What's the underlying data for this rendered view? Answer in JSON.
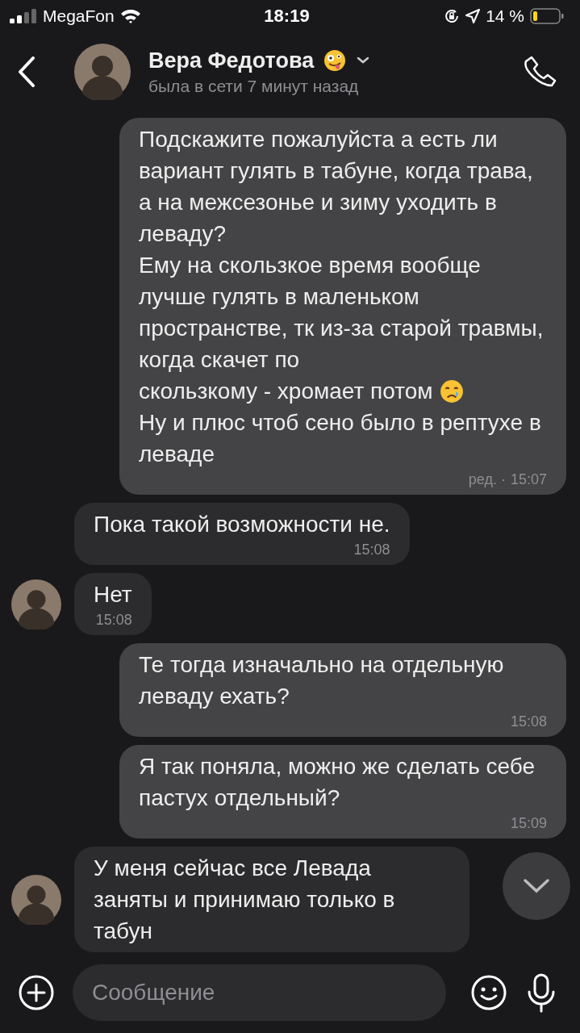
{
  "status_bar": {
    "carrier": "MegaFon",
    "time": "18:19",
    "battery": "14 %"
  },
  "header": {
    "name": "Вера Федотова",
    "status": "была в сети 7 минут назад"
  },
  "messages": [
    {
      "kind": "outgoing",
      "parts": [
        {
          "kind": "text",
          "text": "Подскажите пожалуйста а есть ли вариант гулять в табуне, когда трава, а на межсезонье и зиму уходить в леваду?"
        },
        {
          "kind": "text",
          "text": "Ему на скользкое время вообще лучше гулять в маленьком пространстве, тк из-за старой травмы, когда скачет по"
        },
        {
          "kind": "text",
          "text": "скользкому - хромает потом",
          "crying_emoji": true
        },
        {
          "kind": "text",
          "text": "Ну и плюс чтоб сено было в рептухе в леваде"
        }
      ],
      "edited": "ред. ·",
      "time": "15:07"
    },
    {
      "kind": "incoming",
      "show_avatar": false,
      "parts": [
        {
          "kind": "text",
          "text": "Пока такой возможности не."
        }
      ],
      "time": "15:08"
    },
    {
      "kind": "incoming",
      "show_avatar": true,
      "parts": [
        {
          "kind": "text",
          "text": "Нет"
        }
      ],
      "time": "15:08"
    },
    {
      "kind": "outgoing",
      "parts": [
        {
          "kind": "text",
          "text": "Те тогда изначально на отдельную леваду ехать?"
        }
      ],
      "time": "15:08"
    },
    {
      "kind": "outgoing",
      "parts": [
        {
          "kind": "text",
          "text": "Я так поняла, можно же сделать себе пастух отдельный?"
        }
      ],
      "time": "15:09"
    },
    {
      "kind": "incoming",
      "show_avatar": true,
      "parts": [
        {
          "kind": "text",
          "text": "У меня сейчас все Левада заняты и принимаю только в табун"
        }
      ]
    }
  ],
  "composer": {
    "placeholder": "Сообщение"
  }
}
